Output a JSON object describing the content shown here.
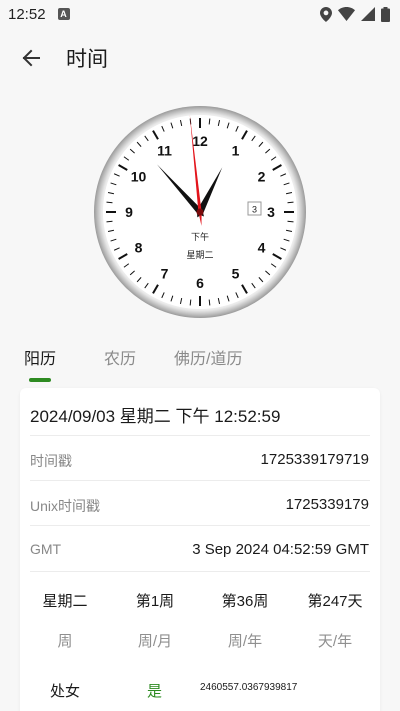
{
  "status_bar": {
    "time": "12:52",
    "notification_icon": "a-badge-icon",
    "icons": [
      "location-icon",
      "wifi-icon",
      "signal-icon",
      "battery-icon"
    ]
  },
  "app_bar": {
    "back_icon": "arrow-left-icon",
    "title": "时间"
  },
  "clock": {
    "hour_numerals": [
      "12",
      "1",
      "2",
      "3",
      "4",
      "5",
      "6",
      "7",
      "8",
      "9",
      "10",
      "11"
    ],
    "date_box": "3",
    "ampm": "下午",
    "weekday": "星期二",
    "time": {
      "hour": 12,
      "minute": 52,
      "second": 59
    },
    "colors": {
      "hands": "#111111",
      "second_hand": "#e3141b",
      "face": "#ffffff"
    }
  },
  "tabs": [
    {
      "label": "阳历",
      "active": true
    },
    {
      "label": "农历",
      "active": false
    },
    {
      "label": "佛历/道历",
      "active": false
    }
  ],
  "accent_color": "#2e8b22",
  "card": {
    "datetime": "2024/09/03 星期二 下午 12:52:59",
    "rows": [
      {
        "label": "时间戳",
        "value": "1725339179719"
      },
      {
        "label": "Unix时间戳",
        "value": "1725339179"
      },
      {
        "label": "GMT",
        "value": "3 Sep 2024 04:52:59 GMT"
      }
    ],
    "grid": [
      {
        "value": "星期二",
        "unit": "周"
      },
      {
        "value": "第1周",
        "unit": "周/月"
      },
      {
        "value": "第36周",
        "unit": "周/年"
      },
      {
        "value": "第247天",
        "unit": "天/年"
      }
    ],
    "zodiac": "处女",
    "zodiac_flag": "是",
    "julian_day": "2460557.0367939817"
  }
}
